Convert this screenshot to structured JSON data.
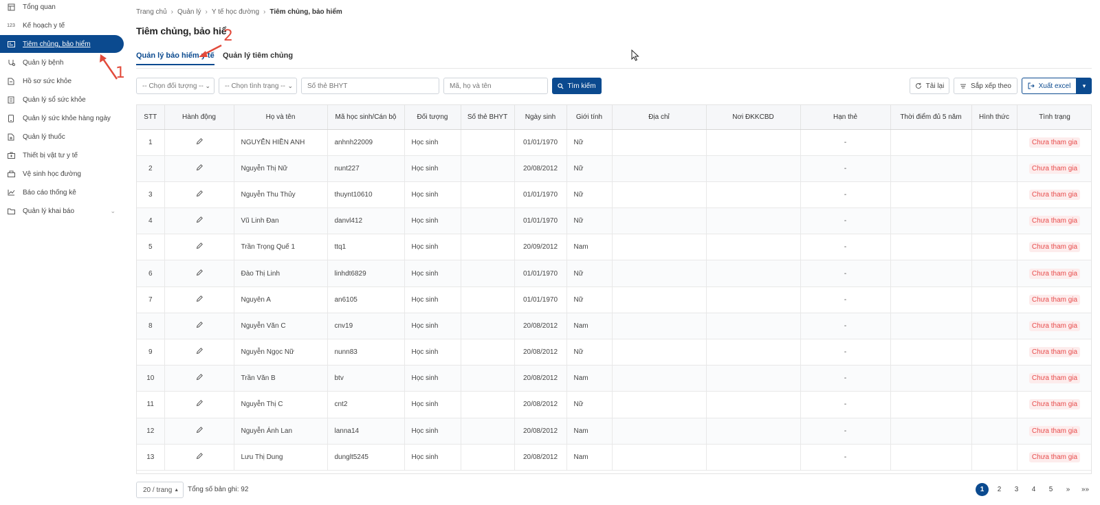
{
  "sidebar": {
    "items": [
      {
        "label": "Tổng quan",
        "icon": "dashboard-icon"
      },
      {
        "label": "Kế hoạch y tế",
        "icon": "number-123-icon"
      },
      {
        "label": "Tiêm chủng, bảo hiểm",
        "icon": "id-card-icon",
        "active": true
      },
      {
        "label": "Quản lý bệnh",
        "icon": "stethoscope-icon"
      },
      {
        "label": "Hồ sơ sức khỏe",
        "icon": "document-icon"
      },
      {
        "label": "Quản lý sổ sức khỏe",
        "icon": "health-book-icon"
      },
      {
        "label": "Quản lý sức khỏe hàng ngày",
        "icon": "phone-icon"
      },
      {
        "label": "Quản lý thuốc",
        "icon": "medicine-file-icon"
      },
      {
        "label": "Thiết bị vật tư y tế",
        "icon": "medical-kit-icon"
      },
      {
        "label": "Vệ sinh học đường",
        "icon": "school-icon"
      },
      {
        "label": "Báo cáo thống kê",
        "icon": "chart-line-icon"
      },
      {
        "label": "Quản lý khai báo",
        "icon": "folder-icon",
        "expandable": true
      }
    ]
  },
  "breadcrumb": [
    "Trang chủ",
    "Quản lý",
    "Y tế học đường",
    "Tiêm chủng, bảo hiểm"
  ],
  "page_title": "Tiêm chủng, bảo hiể",
  "tabs": [
    "Quản lý bảo hiểm y tế",
    "Quản lý tiêm chủng"
  ],
  "filters": {
    "object_select": "-- Chọn đối tượng --",
    "status_select": "-- Chọn tình trạng --",
    "bhyt_placeholder": "Số thẻ BHYT",
    "name_placeholder": "Mã, họ và tên",
    "search_label": "Tìm kiếm",
    "reload_label": "Tải lại",
    "sort_label": "Sắp xếp theo",
    "export_label": "Xuất excel"
  },
  "table": {
    "columns": [
      "STT",
      "Hành động",
      "Họ và tên",
      "Mã học sinh/Cán bộ",
      "Đối tượng",
      "Số thẻ BHYT",
      "Ngày sinh",
      "Giới tính",
      "Địa chỉ",
      "Nơi ĐKKCBD",
      "Hạn thẻ",
      "Thời điểm đủ 5 năm",
      "Hình thức",
      "Tình trạng"
    ],
    "rows": [
      {
        "stt": "1",
        "name": "NGUYỄN HIỀN ANH",
        "code": "anhnh22009",
        "object": "Học sinh",
        "bhyt": "",
        "dob": "01/01/1970",
        "gender": "Nữ",
        "address": "",
        "kcb": "",
        "expiry": "-",
        "five_years": "",
        "form": "",
        "status": "Chưa tham gia"
      },
      {
        "stt": "2",
        "name": "Nguyễn Thị Nữ",
        "code": "nunt227",
        "object": "Học sinh",
        "bhyt": "",
        "dob": "20/08/2012",
        "gender": "Nữ",
        "address": "",
        "kcb": "",
        "expiry": "-",
        "five_years": "",
        "form": "",
        "status": "Chưa tham gia"
      },
      {
        "stt": "3",
        "name": "Nguyễn Thu Thủy",
        "code": "thuynt10610",
        "object": "Học sinh",
        "bhyt": "",
        "dob": "01/01/1970",
        "gender": "Nữ",
        "address": "",
        "kcb": "",
        "expiry": "-",
        "five_years": "",
        "form": "",
        "status": "Chưa tham gia"
      },
      {
        "stt": "4",
        "name": "Vũ Linh Đan",
        "code": "danvl412",
        "object": "Học sinh",
        "bhyt": "",
        "dob": "01/01/1970",
        "gender": "Nữ",
        "address": "",
        "kcb": "",
        "expiry": "-",
        "five_years": "",
        "form": "",
        "status": "Chưa tham gia"
      },
      {
        "stt": "5",
        "name": "Trần Trọng Quế 1",
        "code": "ttq1",
        "object": "Học sinh",
        "bhyt": "",
        "dob": "20/09/2012",
        "gender": "Nam",
        "address": "",
        "kcb": "",
        "expiry": "-",
        "five_years": "",
        "form": "",
        "status": "Chưa tham gia"
      },
      {
        "stt": "6",
        "name": "Đào Thị Linh",
        "code": "linhdt6829",
        "object": "Học sinh",
        "bhyt": "",
        "dob": "01/01/1970",
        "gender": "Nữ",
        "address": "",
        "kcb": "",
        "expiry": "-",
        "five_years": "",
        "form": "",
        "status": "Chưa tham gia"
      },
      {
        "stt": "7",
        "name": "Nguyên A",
        "code": "an6105",
        "object": "Học sinh",
        "bhyt": "",
        "dob": "01/01/1970",
        "gender": "Nữ",
        "address": "",
        "kcb": "",
        "expiry": "-",
        "five_years": "",
        "form": "",
        "status": "Chưa tham gia"
      },
      {
        "stt": "8",
        "name": "Nguyễn Văn C",
        "code": "cnv19",
        "object": "Học sinh",
        "bhyt": "",
        "dob": "20/08/2012",
        "gender": "Nam",
        "address": "",
        "kcb": "",
        "expiry": "-",
        "five_years": "",
        "form": "",
        "status": "Chưa tham gia"
      },
      {
        "stt": "9",
        "name": "Nguyễn Ngọc Nữ",
        "code": "nunn83",
        "object": "Học sinh",
        "bhyt": "",
        "dob": "20/08/2012",
        "gender": "Nữ",
        "address": "",
        "kcb": "",
        "expiry": "-",
        "five_years": "",
        "form": "",
        "status": "Chưa tham gia"
      },
      {
        "stt": "10",
        "name": "Trần Văn B",
        "code": "btv",
        "object": "Học sinh",
        "bhyt": "",
        "dob": "20/08/2012",
        "gender": "Nam",
        "address": "",
        "kcb": "",
        "expiry": "-",
        "five_years": "",
        "form": "",
        "status": "Chưa tham gia"
      },
      {
        "stt": "11",
        "name": "Nguyễn Thị C",
        "code": "cnt2",
        "object": "Học sinh",
        "bhyt": "",
        "dob": "20/08/2012",
        "gender": "Nữ",
        "address": "",
        "kcb": "",
        "expiry": "-",
        "five_years": "",
        "form": "",
        "status": "Chưa tham gia"
      },
      {
        "stt": "12",
        "name": "Nguyễn Ánh Lan",
        "code": "lanna14",
        "object": "Học sinh",
        "bhyt": "",
        "dob": "20/08/2012",
        "gender": "Nam",
        "address": "",
        "kcb": "",
        "expiry": "-",
        "five_years": "",
        "form": "",
        "status": "Chưa tham gia"
      },
      {
        "stt": "13",
        "name": "Lưu Thị Dung",
        "code": "dunglt5245",
        "object": "Học sinh",
        "bhyt": "",
        "dob": "20/08/2012",
        "gender": "Nam",
        "address": "",
        "kcb": "",
        "expiry": "-",
        "five_years": "",
        "form": "",
        "status": "Chưa tham gia"
      }
    ]
  },
  "footer": {
    "page_size": "20 / trang",
    "total": "Tổng số bản ghi: 92",
    "pages": [
      "1",
      "2",
      "3",
      "4",
      "5"
    ],
    "next": "»",
    "last": "»»"
  },
  "annotations": [
    "1",
    "2"
  ],
  "colors": {
    "primary": "#0b4a8f",
    "status_text": "#e74c4c",
    "status_bg": "#fdecec",
    "annotation": "#e24a3b"
  }
}
